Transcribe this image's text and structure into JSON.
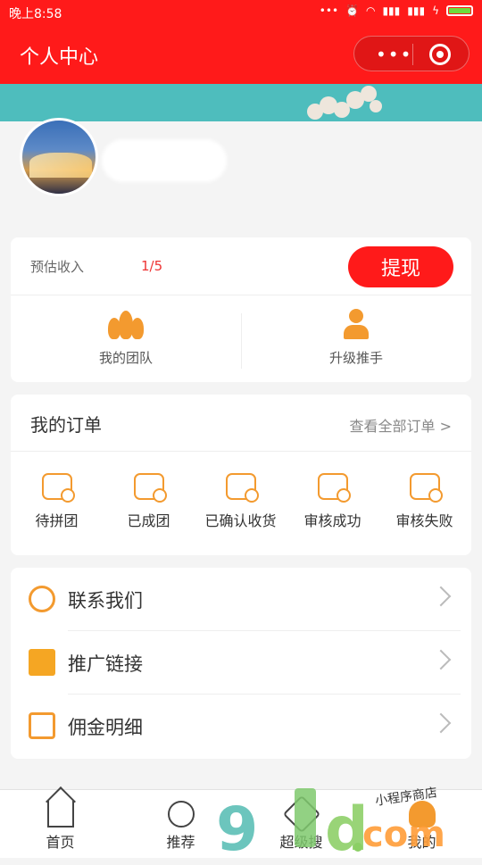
{
  "status_bar": {
    "time": "晚上8:58"
  },
  "navbar": {
    "title": "个人中心",
    "more_label": "•••"
  },
  "profile": {
    "avatar_alt": ""
  },
  "income": {
    "label": "预估收入",
    "value": "1/5",
    "withdraw_label": "提现",
    "actions": [
      {
        "label": "我的团队",
        "icon": "team-icon"
      },
      {
        "label": "升级推手",
        "icon": "promoter-icon"
      }
    ]
  },
  "orders": {
    "title": "我的订单",
    "view_all": "查看全部订单 >",
    "items": [
      {
        "label": "待拼团",
        "icon": "puzzle-icon"
      },
      {
        "label": "已成团",
        "icon": "group-success-icon"
      },
      {
        "label": "已确认收货",
        "icon": "receipt-confirm-icon"
      },
      {
        "label": "审核成功",
        "icon": "audit-success-icon"
      },
      {
        "label": "审核失败",
        "icon": "audit-fail-icon"
      }
    ]
  },
  "menu": [
    {
      "label": "联系我们",
      "icon": "customer-service-icon"
    },
    {
      "label": "推广链接",
      "icon": "promotion-link-icon"
    },
    {
      "label": "佣金明细",
      "icon": "commission-detail-icon"
    }
  ],
  "tabbar": [
    {
      "label": "首页",
      "icon": "home-icon"
    },
    {
      "label": "推荐",
      "icon": "recommend-icon"
    },
    {
      "label": "超级搜",
      "icon": "search-tag-icon"
    },
    {
      "label": "我的",
      "icon": "me-icon"
    }
  ],
  "watermark": {
    "main": "91ud.com",
    "small": "小程序商店"
  }
}
